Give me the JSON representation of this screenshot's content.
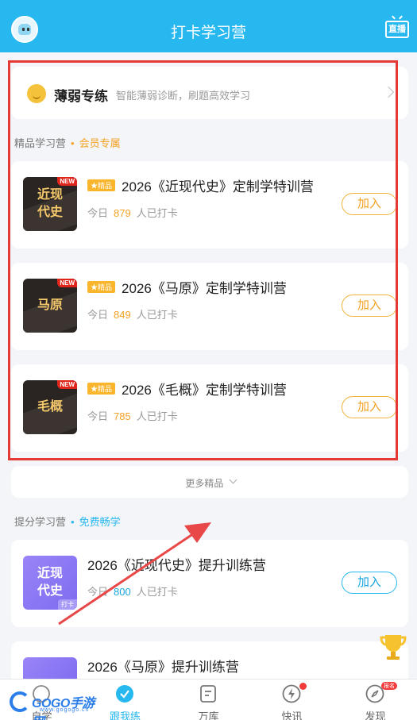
{
  "header": {
    "title": "打卡学习营",
    "live_label": "直播"
  },
  "weak_practice": {
    "title": "薄弱专练",
    "subtitle": "智能薄弱诊断，刷题高效学习"
  },
  "premium_section": {
    "label": "精品学习营",
    "tag": "会员专属",
    "badge_label": "精品",
    "new_label": "NEW",
    "camps": [
      {
        "cover_text": "近现代史",
        "name": "2026《近现代史》定制学特训营",
        "count_prefix": "今日",
        "count": "879",
        "count_suffix": "人已打卡",
        "join_label": "加入"
      },
      {
        "cover_text": "马原",
        "name": "2026《马原》定制学特训营",
        "count_prefix": "今日",
        "count": "849",
        "count_suffix": "人已打卡",
        "join_label": "加入"
      },
      {
        "cover_text": "毛概",
        "name": "2026《毛概》定制学特训营",
        "count_prefix": "今日",
        "count": "785",
        "count_suffix": "人已打卡",
        "join_label": "加入"
      }
    ],
    "more_label": "更多精品"
  },
  "boost_section": {
    "label": "提分学习营",
    "tag": "免费畅学",
    "camps": [
      {
        "cover_text": "近现代史",
        "cover_tag": "打卡",
        "name": "2026《近现代史》提升训练营",
        "count_prefix": "今日",
        "count": "800",
        "count_suffix": "人已打卡",
        "join_label": "加入"
      },
      {
        "name": "2026《马原》提升训练营"
      }
    ]
  },
  "tabbar": {
    "items": [
      {
        "label": "自学",
        "icon": "self-study-icon"
      },
      {
        "label": "跟我练",
        "icon": "check-circle-icon",
        "active": true
      },
      {
        "label": "万库",
        "icon": "library-icon"
      },
      {
        "label": "快讯",
        "icon": "flash-icon",
        "dot": true
      },
      {
        "label": "发现",
        "icon": "compass-icon",
        "badge": "报名"
      }
    ]
  },
  "watermark": {
    "brand": "GOGO手游网",
    "site": "www.gogogo.cn"
  },
  "colors": {
    "primary": "#27b8ef",
    "gold": "#f3a224",
    "highlight_box": "#e53935"
  }
}
